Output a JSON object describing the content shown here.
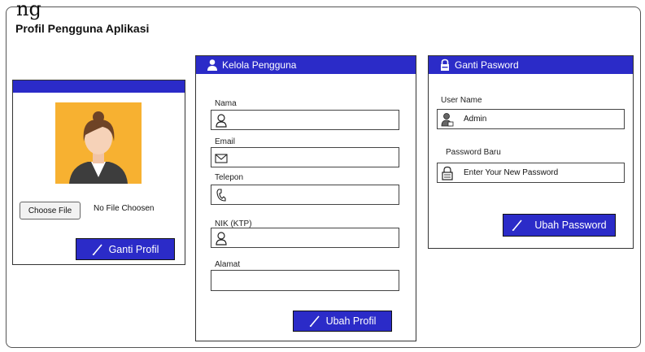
{
  "page": {
    "title": "Profil Pengguna Aplikasi",
    "top_glyph": "ng"
  },
  "profile_card": {
    "choose_file_label": "Choose File",
    "no_file_text": "No File Choosen",
    "ganti_profil_label": "Ganti Profil",
    "avatar_bg": "#f7b131"
  },
  "kelola": {
    "header": "Kelola Pengguna",
    "fields": {
      "nama": {
        "label": "Nama",
        "value": ""
      },
      "email": {
        "label": "Email",
        "value": ""
      },
      "telepon": {
        "label": "Telepon",
        "value": ""
      },
      "nik": {
        "label": "NIK (KTP)",
        "value": ""
      },
      "alamat": {
        "label": "Alamat",
        "value": ""
      }
    },
    "ubah_profil_label": "Ubah Profil"
  },
  "password": {
    "header": "Ganti Pasword",
    "username_label": "User Name",
    "username_value": "Admin",
    "password_label": "Password Baru",
    "password_placeholder": "Enter Your New Password",
    "ubah_password_label": "Ubah Password"
  },
  "colors": {
    "primary": "#2b2bc8",
    "avatar": "#f7b131"
  }
}
